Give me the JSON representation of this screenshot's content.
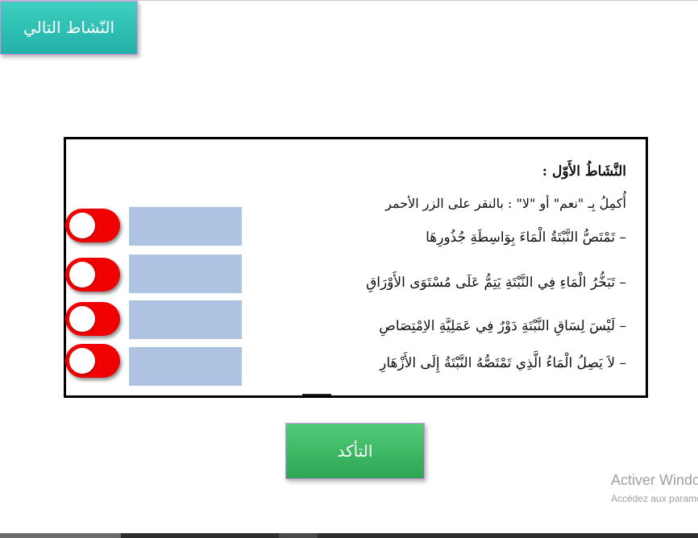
{
  "header": {
    "next_activity_label": "النّشاط التالي"
  },
  "activity": {
    "title": "النَّشَاطُ الأَوّل :",
    "instruction": "أُكمِلُ بِـ \"نعم\" أو \"لا\" :  بالنقر على الزر الأحمر",
    "statements": [
      "– تَمْتَصُّ النَّبْتَةُ الْمَاءَ بِوَاسِطَةِ جُذُورِهَا",
      "– تَبَخُّرُ الْمَاءِ فِي النَّبْتَةِ يَتِمُّ عَلَى مُسْتَوَى الأَوْرَاقِ",
      "– لَيْسَ لِسَاقِ النَّبْتَةِ دَوْرٌ فِي عَمَلِيَّةِ الاِمْتِصَاصِ",
      "– لاَ يَصِلُ الْمَاءُ الَّذِي تَمْتَصُّهُ النَّبْتَةُ إِلَى الأَزْهَارِ"
    ]
  },
  "footer": {
    "check_label": "التأكد"
  },
  "watermark": {
    "line1": "Activer Windows",
    "line2": "Accédez aux paramètres"
  },
  "colors": {
    "next_button": "#2fbfb3",
    "check_button": "#3cb863",
    "toggle": "#f00000",
    "answer_box": "#aec3e2"
  }
}
